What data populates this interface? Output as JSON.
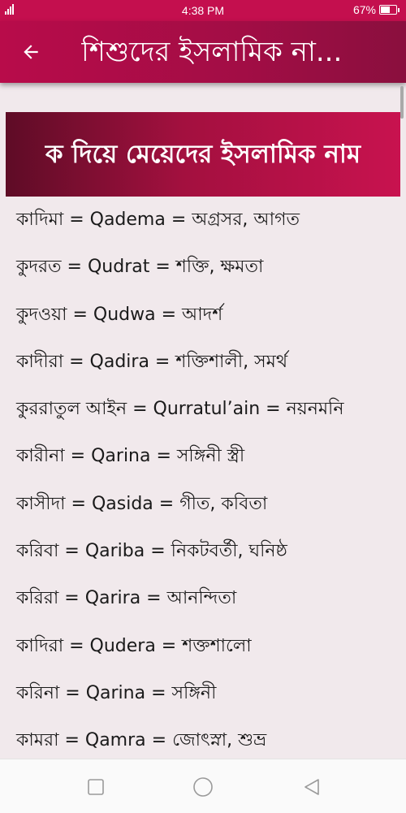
{
  "status_bar": {
    "time": "4:38 PM",
    "battery": "67%",
    "battery_level": 0.67
  },
  "app_bar": {
    "title": "শিশুদের ইসলামিক না..."
  },
  "section": {
    "title": "ক দিয়ে মেয়েদের ইসলামিক নাম"
  },
  "names": [
    "কাদিমা = Qadema = অগ্রসর, আগত",
    "কুদরত = Qudrat = শক্তি, ক্ষমতা",
    "কুদওয়া = Qudwa = আদর্শ",
    "কাদীরা = Qadira = শক্তিশালী, সমর্থ",
    "কুররাতুল  আইন = Qurratul’ain = নয়নমনি",
    "কারীনা = Qarina = সঙ্গিনী  স্ত্রী",
    "কাসীদা = Qasida = গীত, কবিতা",
    "করিবা = Qariba = নিকটবর্তী, ঘনিষ্ঠ",
    "করিরা = Qarira = আনন্দিতা",
    "কাদিরা = Qudera = শক্তশালো",
    "করিনা = Qarina = সঙ্গিনী",
    "কামরা = Qamra = জোৎস্না, শুভ্র"
  ],
  "colors": {
    "primary": "#b80c4a",
    "background": "#f1e9ec"
  }
}
